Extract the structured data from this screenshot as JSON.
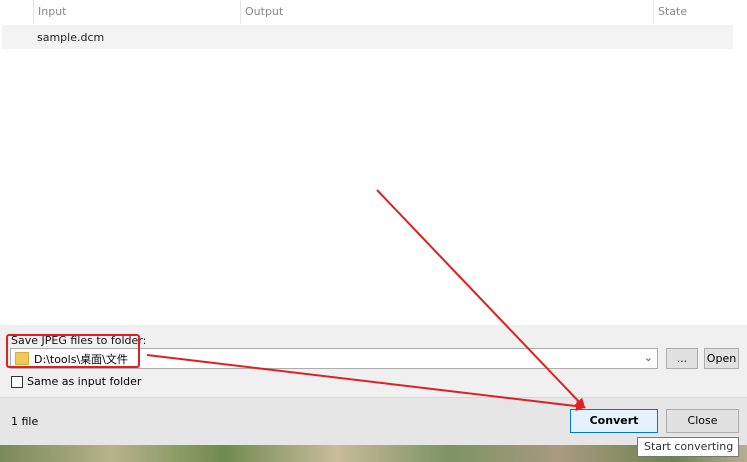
{
  "table": {
    "headers": [
      "Input",
      "Output",
      "State"
    ],
    "rows": [
      {
        "input": "sample.dcm",
        "output": "",
        "state": ""
      }
    ]
  },
  "options": {
    "folder_label": "Save JPEG files to folder:",
    "folder_value": "D:\\tools\\桌面\\文件",
    "browse_label": "...",
    "open_label": "Open",
    "same_as_input_label": "Same as input folder",
    "same_as_input_checked": false
  },
  "footer": {
    "status": "1 file",
    "convert_label": "Convert",
    "close_label": "Close",
    "tooltip": "Start converting"
  },
  "colors": {
    "annotation": "#e02020",
    "convert_accent": "#e5f1fb"
  }
}
